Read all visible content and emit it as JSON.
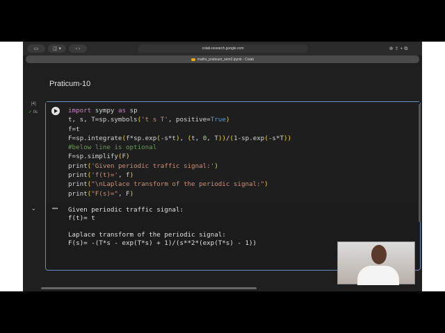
{
  "browser": {
    "url": "colab.research.google.com",
    "tab_title": "maths_praticum_sem2.ipynb - Colab"
  },
  "notebook": {
    "heading": "Praticum-10",
    "cell": {
      "exec_count": "[4]",
      "exec_time": "0s",
      "code": [
        [
          [
            "import",
            "kw"
          ],
          [
            " sympy ",
            ""
          ],
          [
            "as",
            "kw"
          ],
          [
            " sp",
            ""
          ]
        ],
        [
          [
            "t, s, T=sp.symbols",
            ""
          ],
          [
            "(",
            "br"
          ],
          [
            "'t s T'",
            "st"
          ],
          [
            ", positive=",
            ""
          ],
          [
            "True",
            "bl"
          ],
          [
            ")",
            "br"
          ]
        ],
        [
          [
            "f=t",
            ""
          ]
        ],
        [
          [
            "F=sp.integrate",
            ""
          ],
          [
            "(",
            "br"
          ],
          [
            "f*sp.exp",
            ""
          ],
          [
            "(",
            "br"
          ],
          [
            "-s*t",
            ""
          ],
          [
            ")",
            "br"
          ],
          [
            ", ",
            ""
          ],
          [
            "(",
            "br"
          ],
          [
            "t, ",
            ""
          ],
          [
            "0",
            "nm"
          ],
          [
            ", T",
            ""
          ],
          [
            "))",
            "br"
          ],
          [
            "/",
            ""
          ],
          [
            "(",
            "br"
          ],
          [
            "1-sp.exp",
            ""
          ],
          [
            "(",
            "br"
          ],
          [
            "-s*T",
            ""
          ],
          [
            "))",
            "br"
          ]
        ],
        [
          [
            "#below line is optional",
            "cm"
          ]
        ],
        [
          [
            "F=sp.simplify",
            ""
          ],
          [
            "(",
            "br"
          ],
          [
            "F",
            ""
          ],
          [
            ")",
            "br"
          ]
        ],
        [
          [
            "print",
            ""
          ],
          [
            "(",
            "br"
          ],
          [
            "'Given periodic traffic signal:'",
            "st"
          ],
          [
            ")",
            "br"
          ]
        ],
        [
          [
            "print",
            ""
          ],
          [
            "(",
            "br"
          ],
          [
            "'f(t)='",
            "st"
          ],
          [
            ", f",
            ""
          ],
          [
            ")",
            "br"
          ]
        ],
        [
          [
            "print",
            ""
          ],
          [
            "(",
            "br"
          ],
          [
            "\"\\nLaplace transform of the periodic signal:\"",
            "st"
          ],
          [
            ")",
            "br"
          ]
        ],
        [
          [
            "print",
            ""
          ],
          [
            "(",
            "br"
          ],
          [
            "\"F(s)=\"",
            "st"
          ],
          [
            ", F",
            ""
          ],
          [
            ")",
            "br"
          ]
        ]
      ],
      "output": [
        "Given periodic traffic signal:",
        "f(t)= t",
        "",
        "Laplace transform of the periodic signal:",
        "F(s)= -(T*s - exp(T*s) + 1)/(s**2*(exp(T*s) - 1))"
      ]
    }
  }
}
